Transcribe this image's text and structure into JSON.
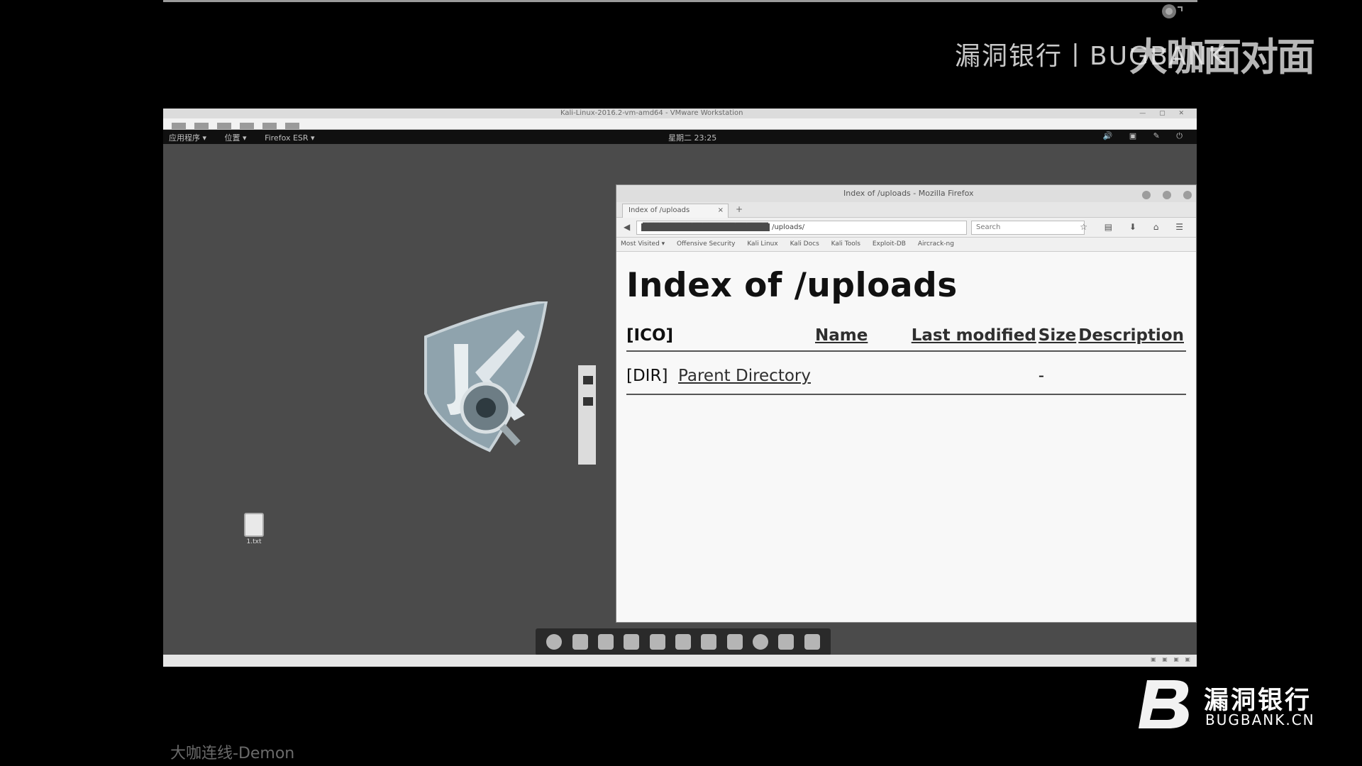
{
  "watermark": {
    "text": "漏洞银行丨BUGBANK",
    "overlay": "大咖面对面"
  },
  "vm": {
    "window_title": "Kali-Linux-2016.2-vm-amd64 - VMware Workstation",
    "gnome_bar": {
      "applications": "应用程序 ▾",
      "places": "位置 ▾",
      "app_menu": "Firefox ESR ▾",
      "clock": "星期二 23:25"
    },
    "desktop_file_label": "1.txt"
  },
  "firefox": {
    "window_title": "Index of /uploads - Mozilla Firefox",
    "tab_label": "Index of /uploads",
    "tab_close": "×",
    "new_tab": "+",
    "url_tail": "/uploads/",
    "search_placeholder": "Search",
    "bookmarks": [
      "Most Visited ▾",
      "Offensive Security",
      "Kali Linux",
      "Kali Docs",
      "Kali Tools",
      "Exploit-DB",
      "Aircrack-ng"
    ],
    "page": {
      "heading": "Index of /uploads",
      "columns": {
        "icon": "[ICO]",
        "name": "Name",
        "last_modified": "Last modified",
        "size": "Size",
        "description": "Description"
      },
      "rows": [
        {
          "icon": "[DIR]",
          "name": "Parent Directory",
          "last_modified": "",
          "size": "-",
          "description": ""
        }
      ]
    }
  },
  "branding": {
    "cn": "漏洞银行",
    "en": "BUGBANK.CN"
  },
  "presenter": "大咖连线-Demon",
  "colors": {
    "desktop": "#4b4b4b",
    "page_bg": "#f8f8f8",
    "background": "#000000"
  }
}
